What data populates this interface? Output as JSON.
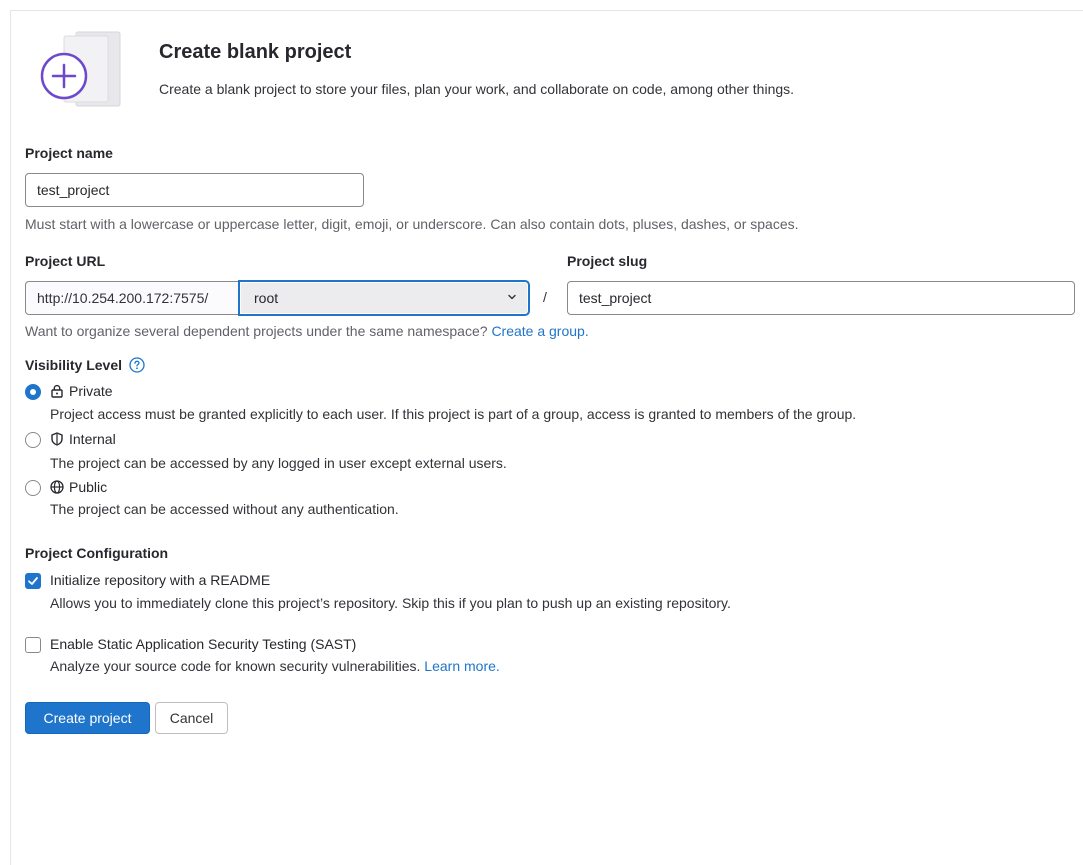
{
  "hero": {
    "title": "Create blank project",
    "description": "Create a blank project to store your files, plan your work, and collaborate on code, among other things."
  },
  "project_name": {
    "label": "Project name",
    "value": "test_project",
    "help": "Must start with a lowercase or uppercase letter, digit, emoji, or underscore. Can also contain dots, pluses, dashes, or spaces."
  },
  "project_url": {
    "label": "Project URL",
    "prefix": "http://10.254.200.172:7575/",
    "namespace": "root",
    "separator": "/",
    "help": "Want to organize several dependent projects under the same namespace?",
    "help_link": "Create a group."
  },
  "project_slug": {
    "label": "Project slug",
    "value": "test_project"
  },
  "visibility": {
    "label": "Visibility Level",
    "options": [
      {
        "label": "Private",
        "icon": "lock-icon",
        "checked": true,
        "description": "Project access must be granted explicitly to each user. If this project is part of a group, access is granted to members of the group."
      },
      {
        "label": "Internal",
        "icon": "shield-icon",
        "checked": false,
        "description": "The project can be accessed by any logged in user except external users."
      },
      {
        "label": "Public",
        "icon": "globe-icon",
        "checked": false,
        "description": "The project can be accessed without any authentication."
      }
    ]
  },
  "configuration": {
    "label": "Project Configuration",
    "readme": {
      "label": "Initialize repository with a README",
      "checked": true,
      "description": "Allows you to immediately clone this project’s repository. Skip this if you plan to push up an existing repository."
    },
    "sast": {
      "label": "Enable Static Application Security Testing (SAST)",
      "checked": false,
      "description": "Analyze your source code for known security vulnerabilities.",
      "link": "Learn more."
    }
  },
  "actions": {
    "create": "Create project",
    "cancel": "Cancel"
  },
  "colors": {
    "accent": "#1f75cb",
    "illustration": "#6e49cb"
  }
}
